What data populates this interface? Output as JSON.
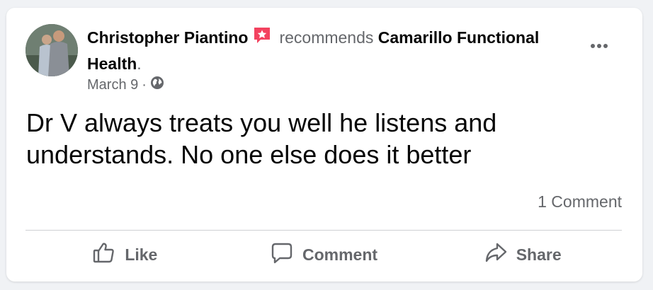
{
  "post": {
    "author": "Christopher Piantino",
    "action_text": "recommends",
    "page_name": "Camarillo Functional Health",
    "page_suffix": ".",
    "date": "March 9",
    "separator": "·",
    "privacy_icon": "globe-icon",
    "body": "Dr V always treats you well he listens and understands. No one else does it better",
    "comments_count": "1 Comment"
  },
  "actions": {
    "like_label": "Like",
    "comment_label": "Comment",
    "share_label": "Share"
  },
  "colors": {
    "badge": "#f3425f",
    "secondary_text": "#65676b",
    "primary_text": "#050505",
    "background": "#f0f2f5"
  }
}
